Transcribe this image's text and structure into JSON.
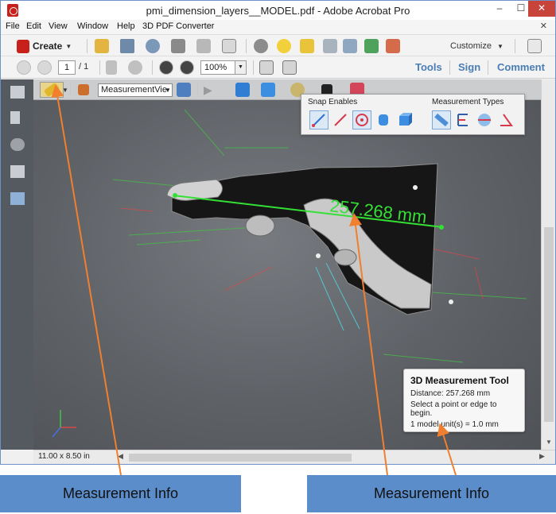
{
  "window": {
    "title": "pmi_dimension_layers__MODEL.pdf - Adobe Acrobat Pro",
    "controls": {
      "minimize": "–",
      "maximize": "☐",
      "close": "✕"
    }
  },
  "menu": {
    "items": [
      "File",
      "Edit",
      "View",
      "Window",
      "Help",
      "3D PDF Converter"
    ],
    "close_doc": "✕"
  },
  "toolbar": {
    "create_label": "Create",
    "customize_label": "Customize"
  },
  "navigation": {
    "page_number": "1",
    "page_total": "/ 1",
    "zoom": "100%"
  },
  "panes": {
    "tools": "Tools",
    "sign": "Sign",
    "comment": "Comment"
  },
  "toolbar3d": {
    "view_select": "MeasurementVie"
  },
  "snap_panel": {
    "snap_title": "Snap Enables",
    "types_title": "Measurement Types"
  },
  "model": {
    "dimension_label": "257.268 mm"
  },
  "measurement_info": {
    "title": "3D Measurement Tool",
    "distance": "Distance: 257.268 mm",
    "instruction": "Select a point or edge to begin.",
    "units": "1 model unit(s) = 1.0 mm"
  },
  "status": {
    "page_size": "11.00 x 8.50 in"
  },
  "callouts": {
    "left": "Measurement Info",
    "right": "Measurement Info"
  },
  "colors": {
    "callout_bg": "#5b8dcb",
    "arrow": "#f07f2f",
    "dimension": "#35e035",
    "pane_links": "#4a7db5"
  }
}
